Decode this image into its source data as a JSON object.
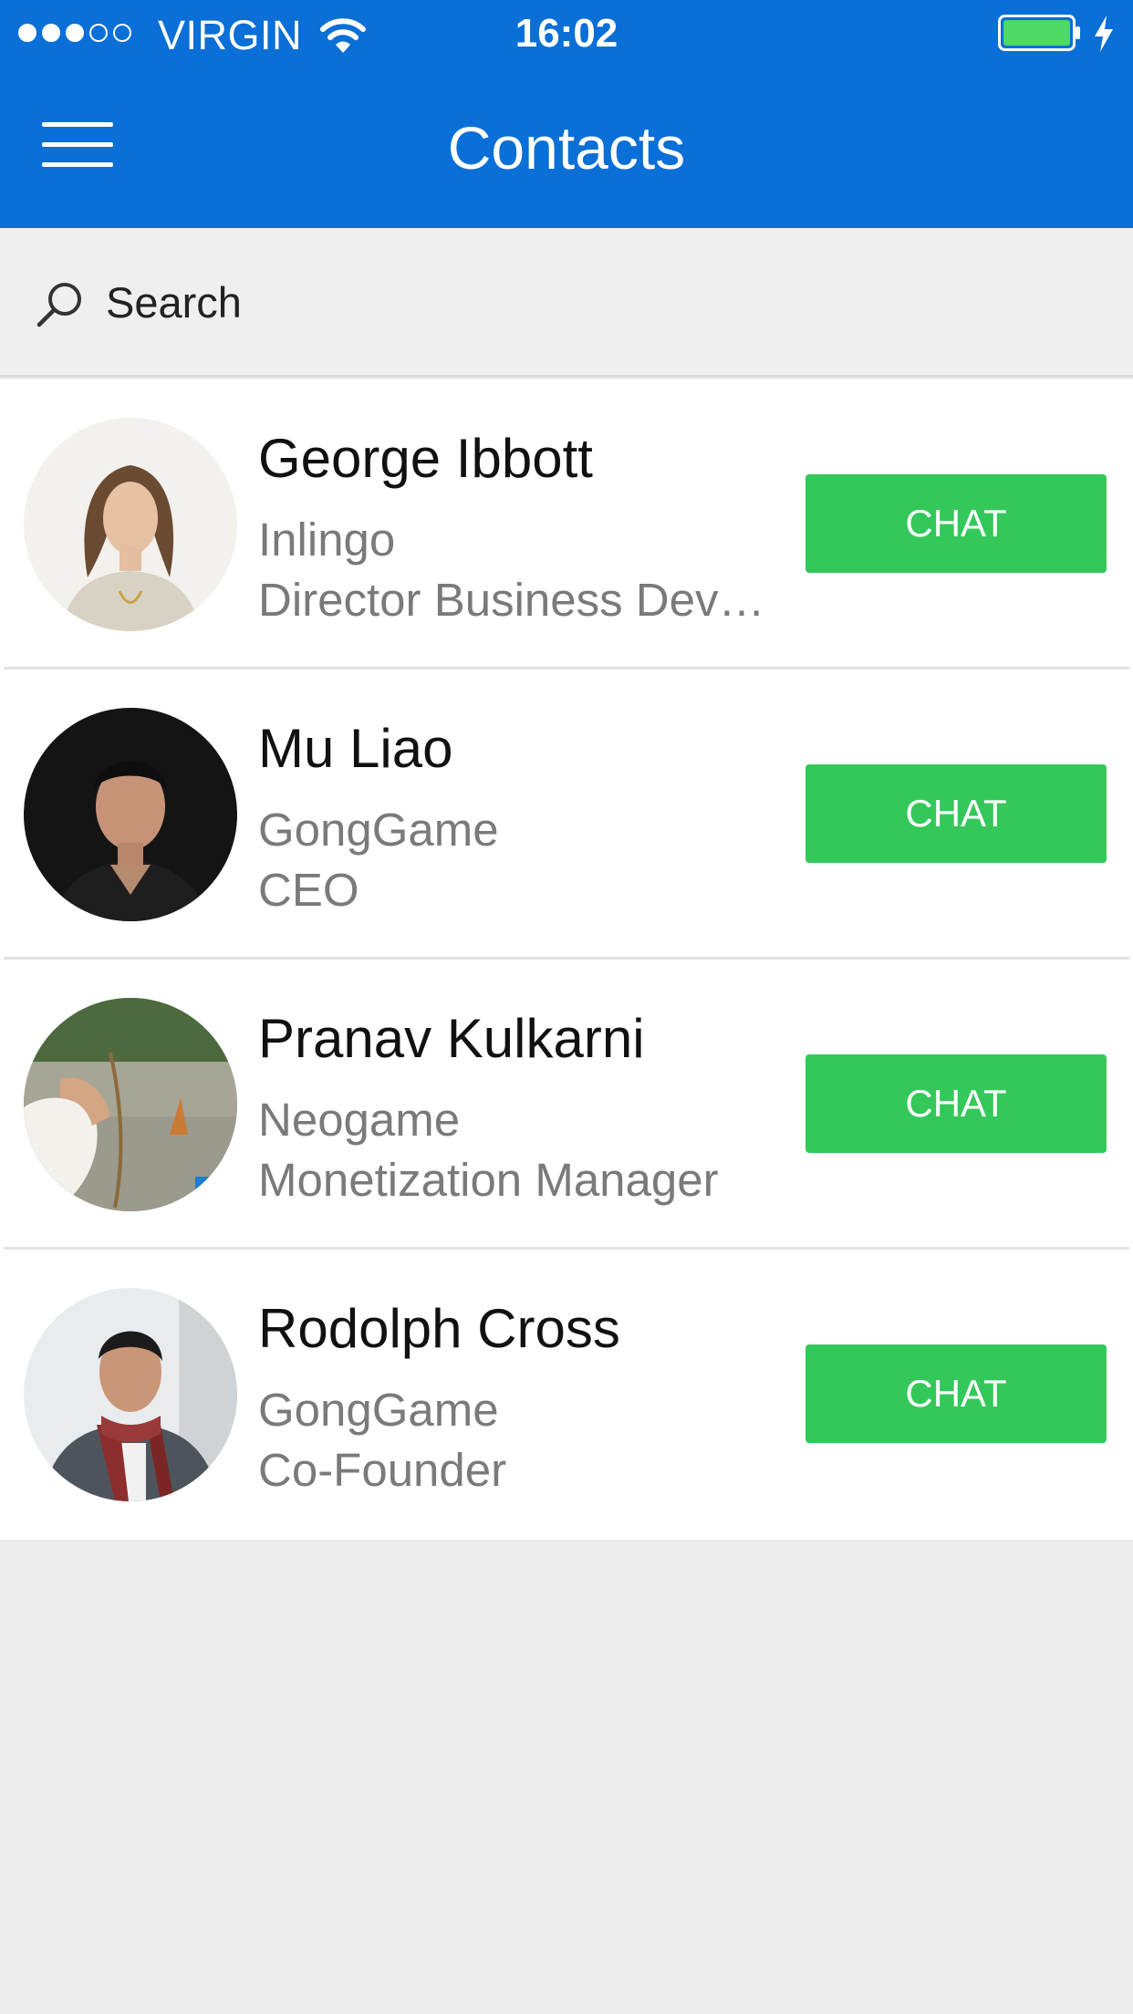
{
  "status_bar": {
    "carrier": "VIRGIN",
    "time": "16:02",
    "signal_bars_filled": 3,
    "signal_bars_total": 5,
    "battery_icon": "battery-full-icon",
    "charging_icon": "charging-bolt-icon"
  },
  "header": {
    "title": "Contacts",
    "menu_icon": "hamburger-menu-icon",
    "background_color": "#0a6fd6"
  },
  "search": {
    "placeholder": "Search",
    "icon": "search-icon"
  },
  "contacts": [
    {
      "name": "George Ibbott",
      "company": "Inlingo",
      "role": "Director Business Development",
      "chat_label": "CHAT"
    },
    {
      "name": "Mu Liao",
      "company": "GongGame",
      "role": "CEO",
      "chat_label": "CHAT"
    },
    {
      "name": "Pranav Kulkarni",
      "company": "Neogame",
      "role": "Monetization Manager",
      "chat_label": "CHAT"
    },
    {
      "name": "Rodolph Cross",
      "company": "GongGame",
      "role": "Co-Founder",
      "chat_label": "CHAT"
    }
  ],
  "colors": {
    "chat_button": "#34c85a",
    "page_background": "#ededed"
  }
}
